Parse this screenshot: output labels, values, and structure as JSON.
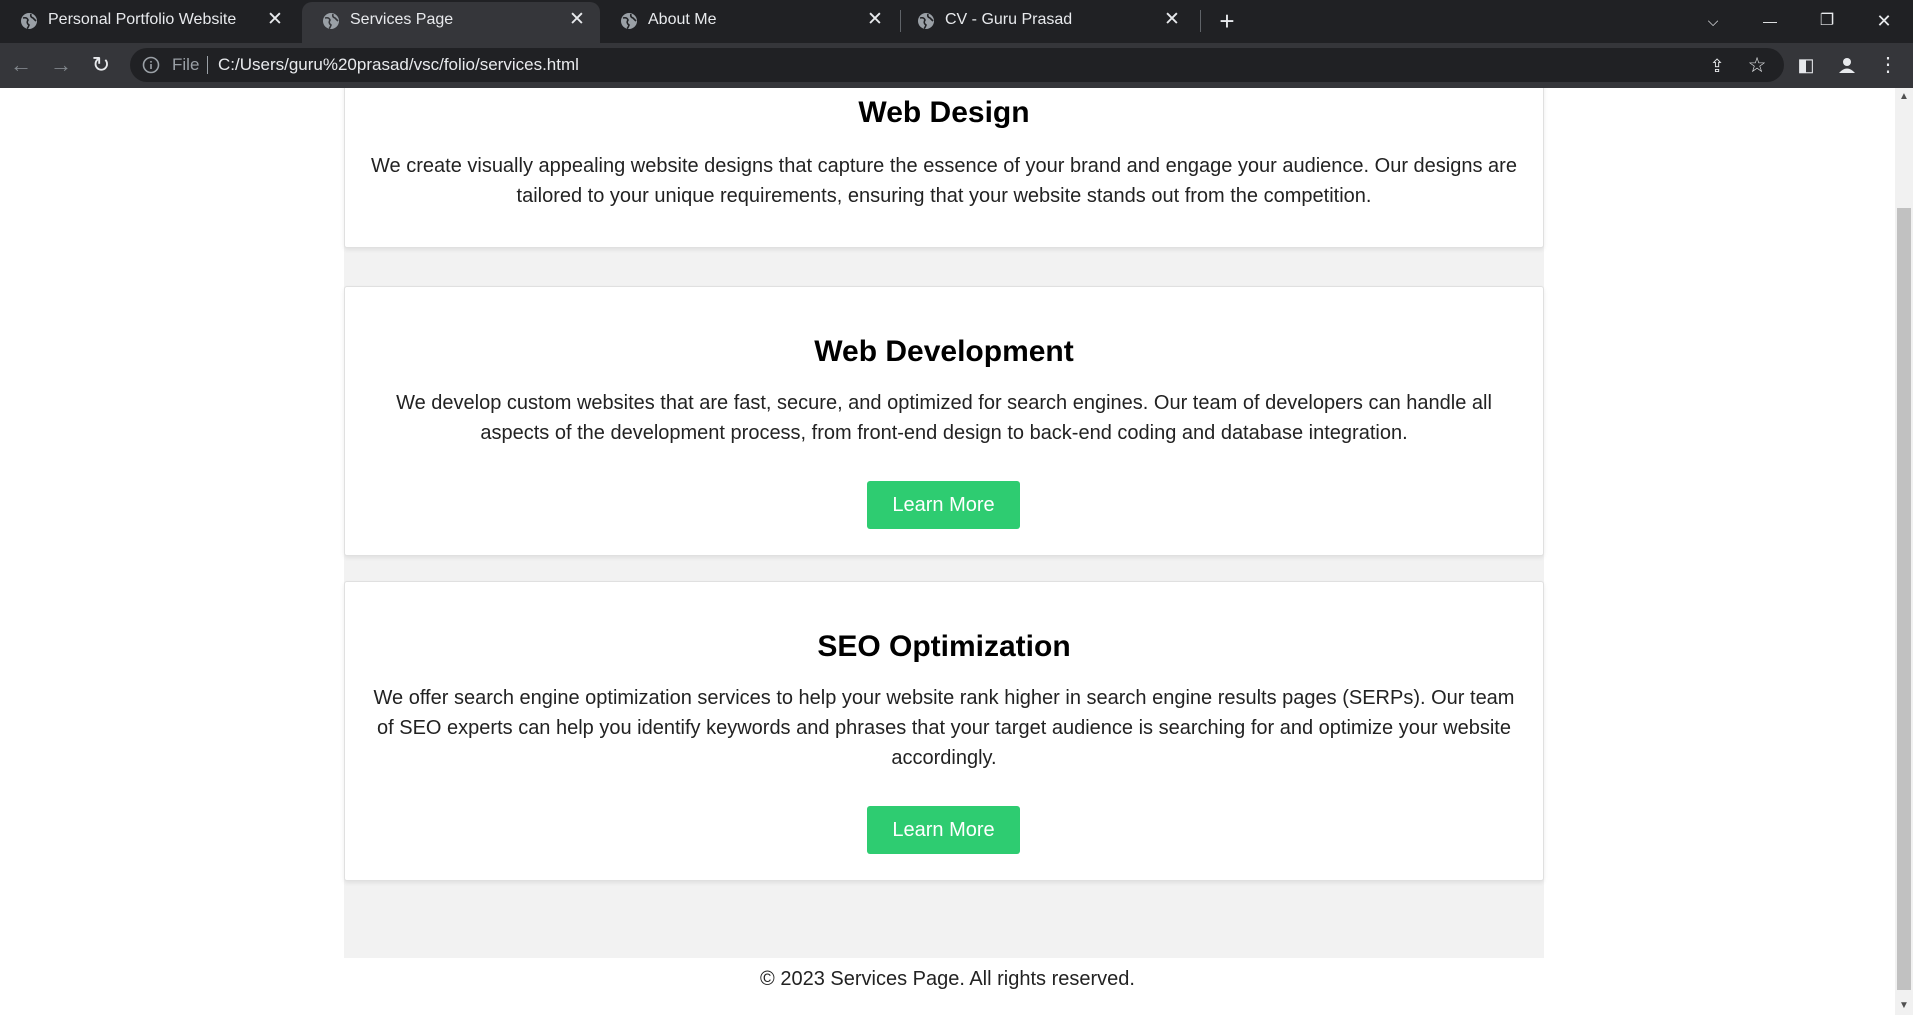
{
  "tabs": [
    {
      "title": "Personal Portfolio Website",
      "close": "✕"
    },
    {
      "title": "Services Page",
      "close": "✕"
    },
    {
      "title": "About Me",
      "close": "✕"
    },
    {
      "title": "CV - Guru Prasad",
      "close": "✕"
    }
  ],
  "tabstrip": {
    "new_tab": "+",
    "tab_search": "⌵",
    "minimize": "—",
    "restore": "❐",
    "close_window": "✕"
  },
  "toolbar": {
    "back": "←",
    "forward": "→",
    "reload": "↻",
    "scheme_label": "File",
    "url": "C:/Users/guru%20prasad/vsc/folio/services.html",
    "share": "⇪",
    "bookmark": "☆",
    "side_panel": "◧",
    "profile": "●",
    "menu": "⋮"
  },
  "services": [
    {
      "title": "Web Design",
      "description": "We create visually appealing website designs that capture the essence of your brand and engage your audience. Our designs are tailored to your unique requirements, ensuring that your website stands out from the competition."
    },
    {
      "title": "Web Development",
      "description": "We develop custom websites that are fast, secure, and optimized for search engines. Our team of developers can handle all aspects of the development process, from front-end design to back-end coding and database integration.",
      "button": "Learn More"
    },
    {
      "title": "SEO Optimization",
      "description": "We offer search engine optimization services to help your website rank higher in search engine results pages (SERPs). Our team of SEO experts can help you identify keywords and phrases that your target audience is searching for and optimize your website accordingly.",
      "button": "Learn More"
    }
  ],
  "footer": {
    "text": "© 2023 Services Page. All rights reserved."
  },
  "colors": {
    "accent": "#2ecc71",
    "tabstrip_bg": "#202124",
    "toolbar_bg": "#35363a",
    "page_bg": "#f2f2f2"
  },
  "icons": [
    "globe-icon",
    "info-icon",
    "share-icon",
    "star-icon",
    "side-panel-icon",
    "profile-icon",
    "menu-icon"
  ]
}
